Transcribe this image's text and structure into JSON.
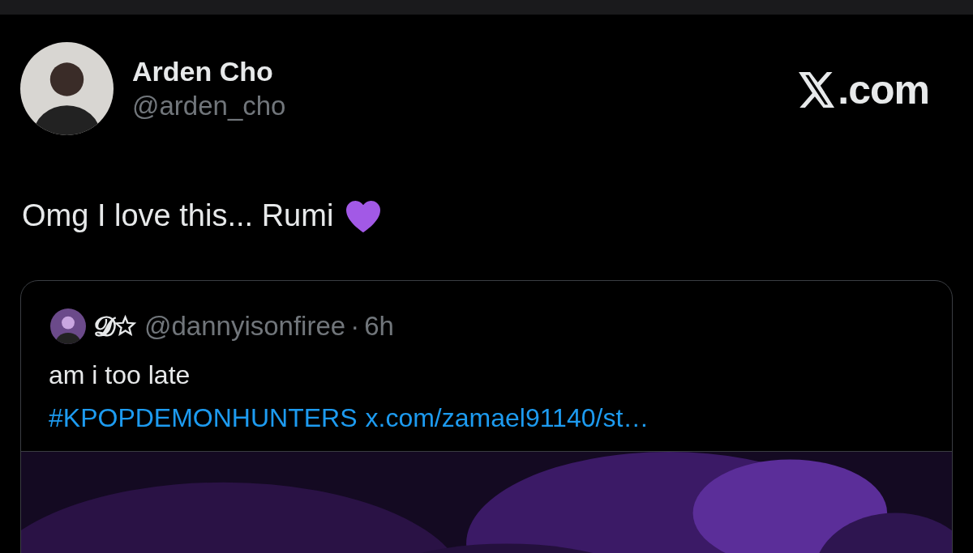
{
  "author": {
    "name": "Arden Cho",
    "handle": "@arden_cho"
  },
  "brand": {
    "suffix": ".com"
  },
  "tweet": {
    "text": "Omg I love this... Rumi"
  },
  "quote": {
    "name": "𝓓☆",
    "handle": "@dannyisonfiree",
    "separator": "·",
    "time": "6h",
    "text": "am i too late",
    "hashtag": "#KPOPDEMONHUNTERS",
    "link": "x.com/zamael91140/st…"
  }
}
